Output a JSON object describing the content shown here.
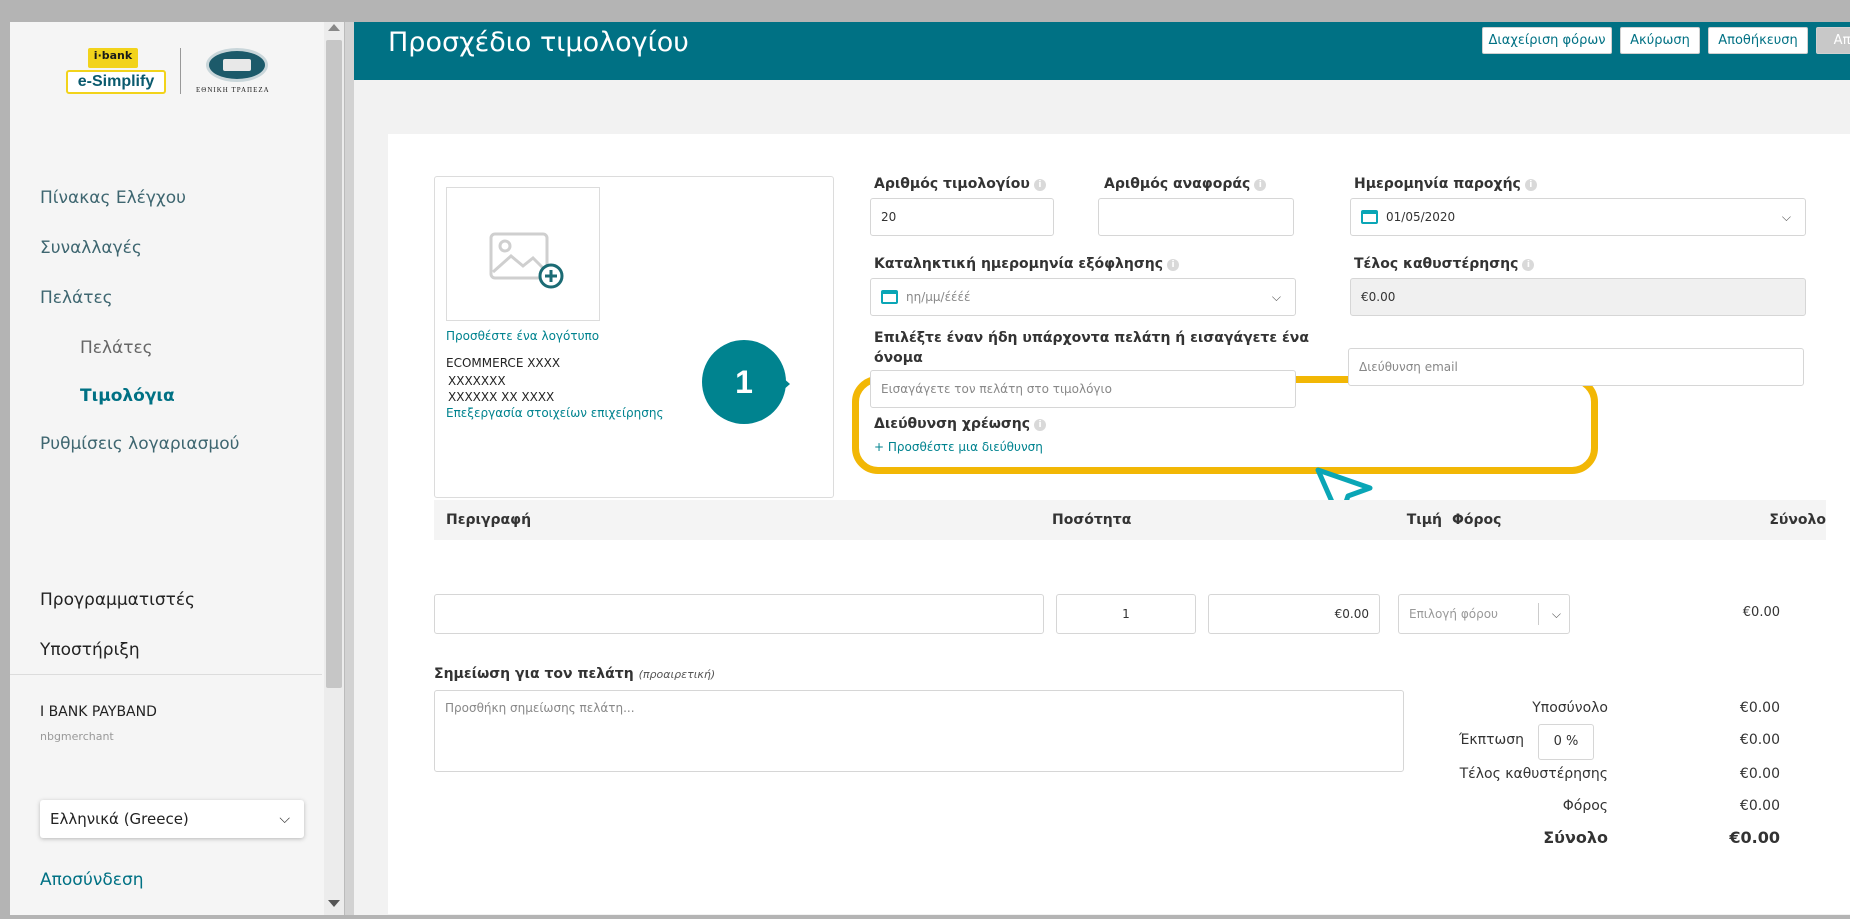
{
  "brand": {
    "ibank_label": "i·bank",
    "app_label": "e-Simplify",
    "bank_name": "ΕΘΝΙΚΗ ΤΡΑΠΕΖΑ"
  },
  "sidebar": {
    "items": [
      {
        "label": "Πίνακας Ελέγχου"
      },
      {
        "label": "Συναλλαγές"
      },
      {
        "label": "Πελάτες"
      },
      {
        "label": "Πελάτες"
      },
      {
        "label": "Τιμολόγια"
      },
      {
        "label": "Ρυθμίσεις λογαριασμού"
      }
    ],
    "developers": "Προγραμματιστές",
    "support": "Υποστήριξη",
    "merchant_name": "I BANK PAYBAND",
    "merchant_user": "nbgmerchant",
    "language": "Ελληνικά (Greece)",
    "logout": "Αποσύνδεση"
  },
  "header": {
    "title": "Προσχέδιο τιμολογίου",
    "buttons": {
      "manage_taxes": "Διαχείριση φόρων",
      "cancel": "Ακύρωση",
      "save": "Αποθήκευση",
      "send": "Αποστολή"
    }
  },
  "business": {
    "add_logo": "Προσθέστε ένα λογότυπο",
    "line1": "ECOMMERCE  XXXX",
    "line2": "XXXXXXX",
    "line3": "XXXXXX XX XXXX",
    "edit_link": "Επεξεργασία στοιχείων επιχείρησης"
  },
  "form": {
    "invoice_number_label": "Αριθμός τιμολογίου",
    "invoice_number_value": "20",
    "reference_label": "Αριθμός αναφοράς",
    "reference_value": "",
    "service_date_label": "Ημερομηνία παροχής",
    "service_date_value": "01/05/2020",
    "due_date_label": "Καταληκτική ημερομηνία εξόφλησης",
    "due_date_placeholder": "ηη/μμ/έέέέ",
    "late_fee_label": "Τέλος καθυστέρησης",
    "late_fee_value": "€0.00",
    "customer_label": "Επιλέξτε έναν ήδη υπάρχοντα πελάτη ή εισαγάγετε ένα όνομα",
    "customer_placeholder": "Εισαγάγετε τον πελάτη στο τιμολόγιο",
    "email_placeholder": "Διεύθυνση email",
    "billing_label": "Διεύθυνση χρέωσης",
    "add_address": "+ Προσθέστε μια διεύθυνση"
  },
  "callout": {
    "number": "1"
  },
  "table": {
    "headers": {
      "description": "Περιγραφή",
      "quantity": "Ποσότητα",
      "price": "Τιμή",
      "tax": "Φόρος",
      "total": "Σύνολο"
    },
    "row": {
      "description": "",
      "quantity": "1",
      "price": "€0.00",
      "tax_placeholder": "Επιλογή φόρου",
      "total": "€0.00"
    }
  },
  "note": {
    "label": "Σημείωση για τον πελάτη",
    "optional": "(προαιρετική)",
    "placeholder": "Προσθήκη σημείωσης πελάτη..."
  },
  "summary": {
    "subtotal_label": "Υποσύνολο",
    "subtotal_value": "€0.00",
    "discount_label": "Έκπτωση",
    "discount_input": "0 %",
    "discount_value": "€0.00",
    "late_fee_label": "Τέλος καθυστέρησης",
    "late_fee_value": "€0.00",
    "tax_label": "Φόρος",
    "tax_value": "€0.00",
    "total_label": "Σύνολο",
    "total_value": "€0.00"
  },
  "colors": {
    "primary": "#007184",
    "highlight": "#f2b705",
    "link": "#00838f"
  }
}
